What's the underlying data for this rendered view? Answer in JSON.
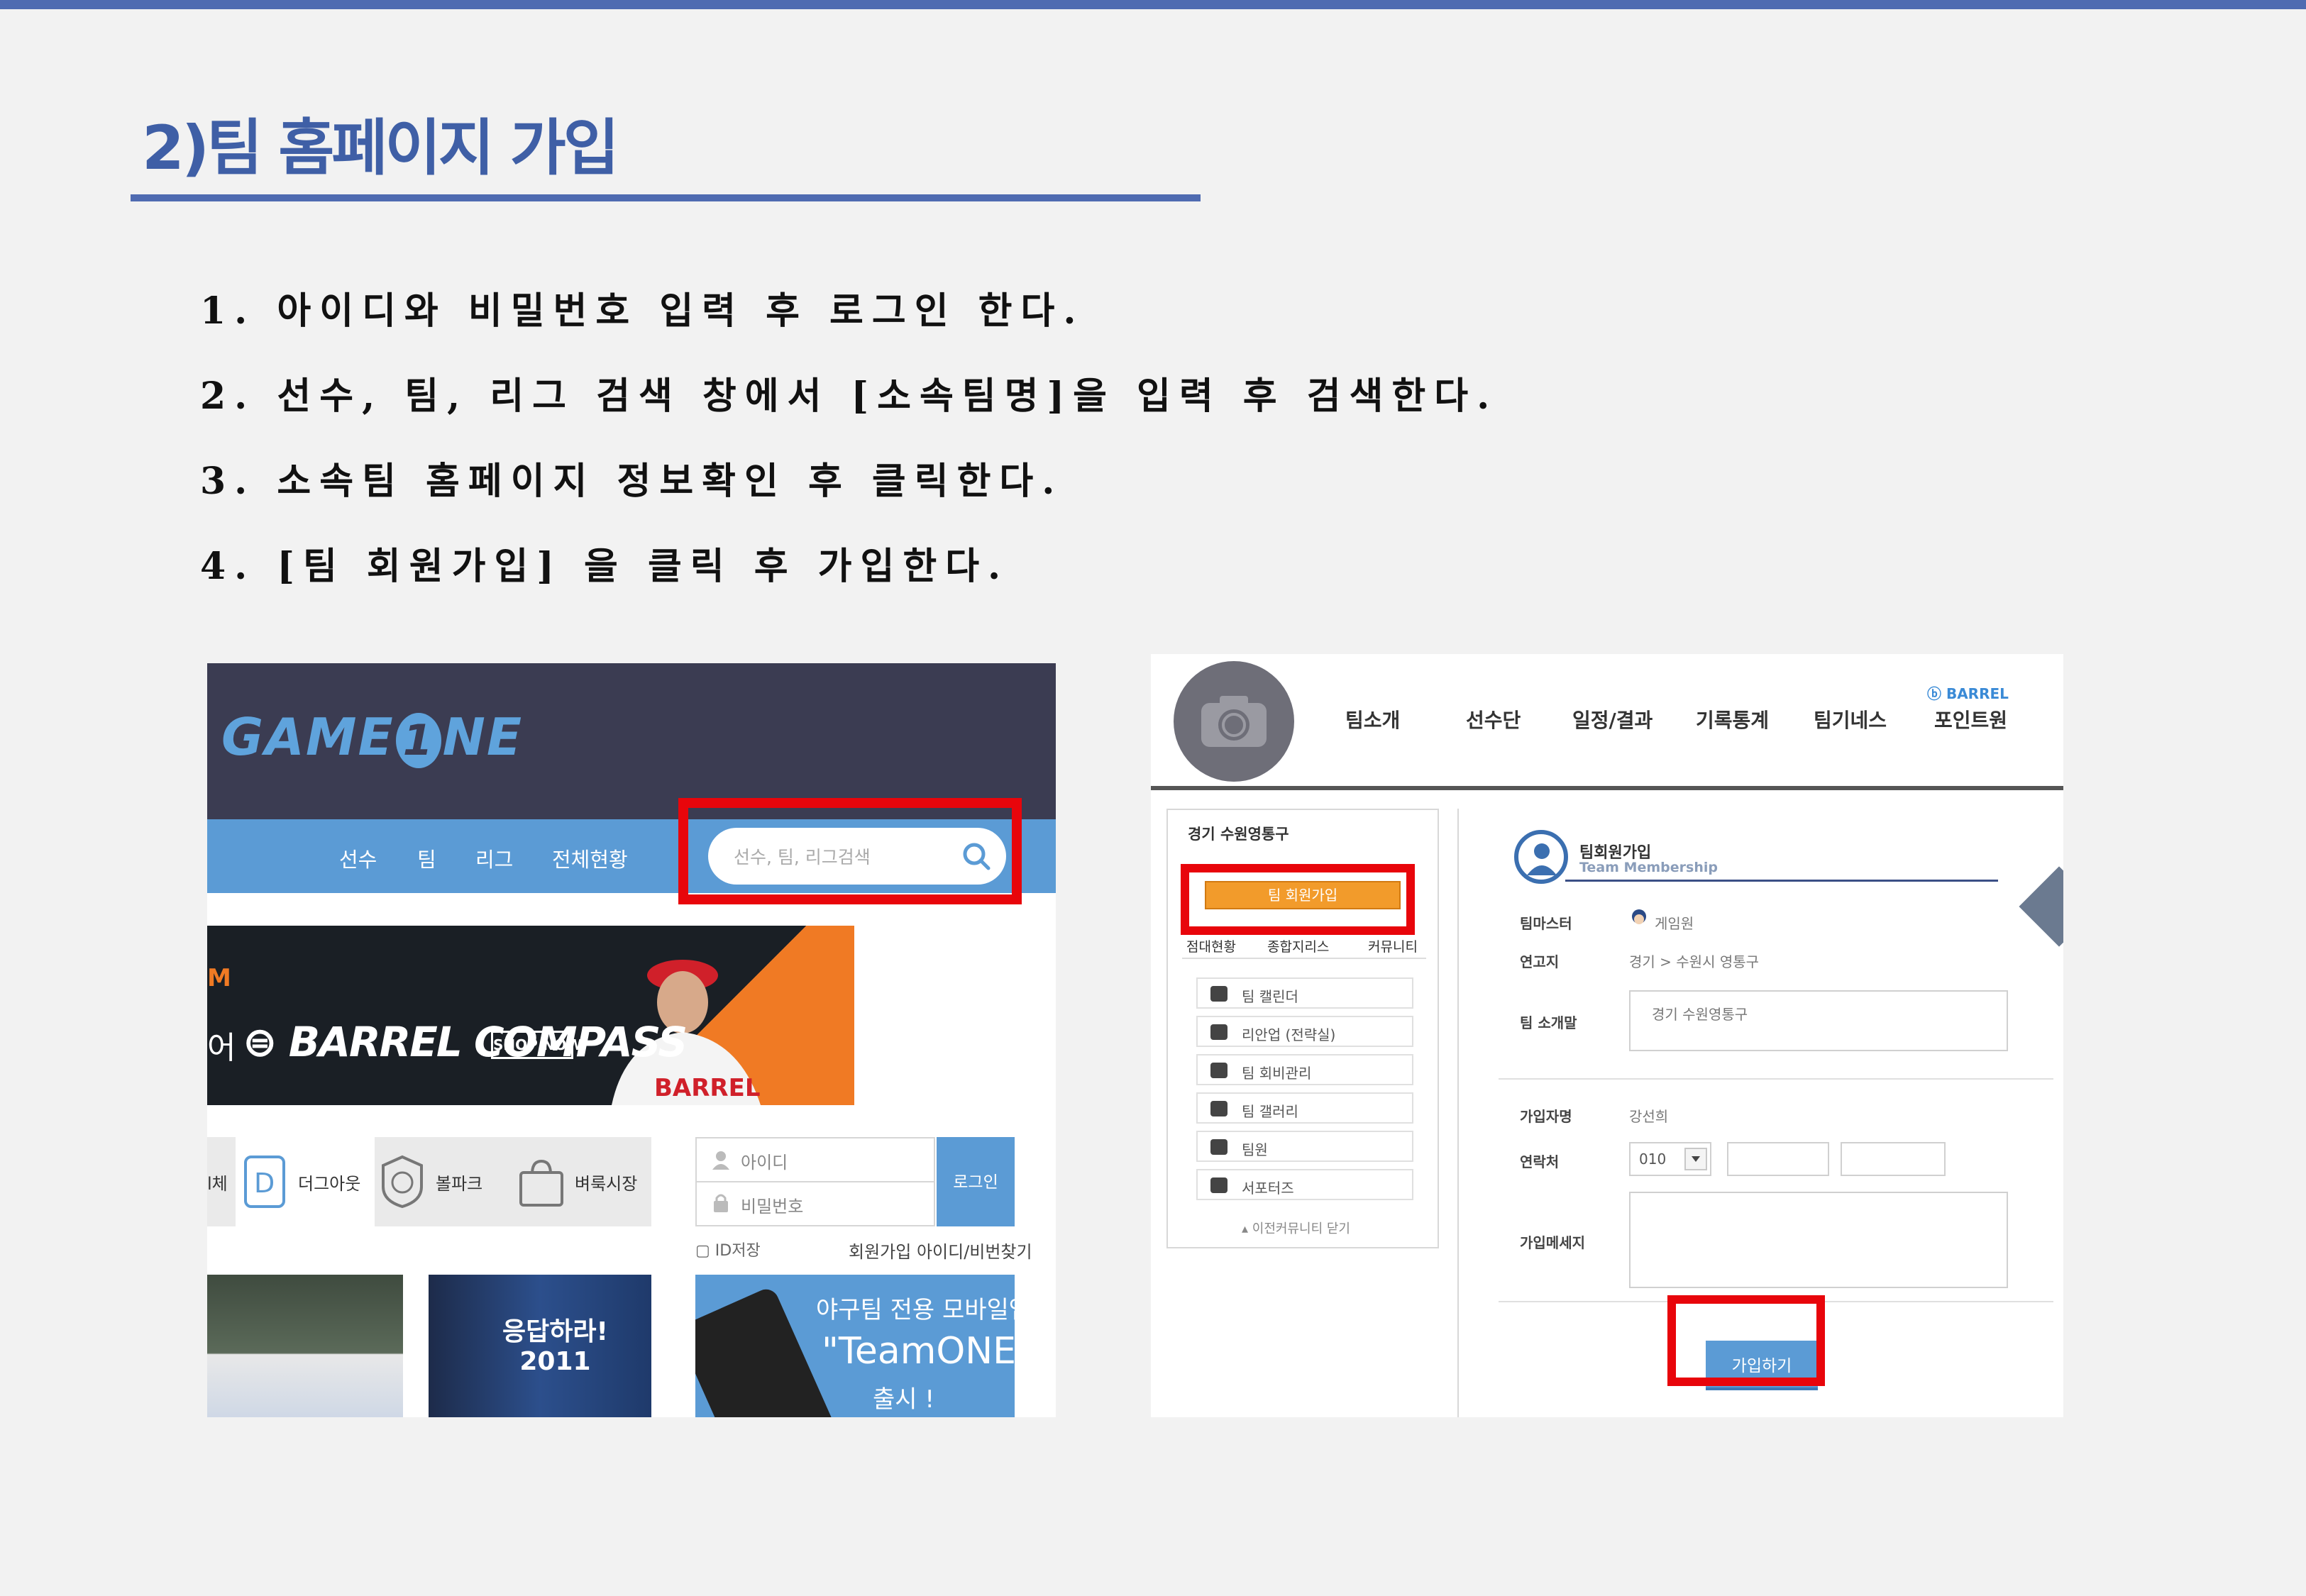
{
  "slide": {
    "title": "2)팀 홈페이지 가입",
    "steps": [
      "1. 아이디와 비밀번호 입력 후 로그인 한다.",
      "2. 선수, 팀, 리그 검색 창에서 [소속팀명]을 입력 후 검색한다.",
      "3. 소속팀 홈페이지 정보확인 후 클릭한다.",
      "4. [팀 회원가입] 을 클릭 후 가입한다."
    ]
  },
  "left": {
    "logo_pre": "GAME",
    "logo_one": "1",
    "logo_post": "NE",
    "nav": [
      "선수",
      "팀",
      "리그",
      "전체현황"
    ],
    "search_placeholder": "선수, 팀, 리그검색",
    "banner_m": "M",
    "banner_eo": "어",
    "banner_compass": "⊜ BARREL COMPASS",
    "banner_shop": "SHOP NOW",
    "icon_items": [
      "l체",
      "더그아웃",
      "볼파크",
      "벼룩시장"
    ],
    "login_id": "아이디",
    "login_pw": "비밀번호",
    "login_button": "로그인",
    "id_save": "ID저장",
    "join_links": "회원가입  아이디/비번찾기",
    "photo2_text": "응답하라!\n2011",
    "app_line1": "야구팀 전용 모바일앱",
    "app_line2": "\"TeamONE\"",
    "app_line3": "출시 !"
  },
  "right": {
    "nav": [
      "팀소개",
      "선수단",
      "일정/결과",
      "기록통계",
      "팀기네스",
      "포인트원"
    ],
    "barrel": "ⓑ BARREL",
    "team_name": "경기 수원영통구",
    "join_button": "팀 회원가입",
    "tabs": [
      "점대현황",
      "종합지리스",
      "커뮤니티"
    ],
    "menu": [
      "팀 캘린더",
      "리안업 (전략실)",
      "팀 회비관리",
      "팀 갤러리",
      "팀원",
      "서포터즈"
    ],
    "collapse": "이전커뮤니티 닫기",
    "form_title": "팀회원가입",
    "form_subtitle": "Team Membership",
    "labels": {
      "master": "팀마스터",
      "region": "연고지",
      "intro": "팀 소개말",
      "name": "가입자명",
      "phone": "연락처",
      "message": "가입메세지"
    },
    "values": {
      "master": "게임원",
      "region": "경기 > 수원시 영통구",
      "intro": "경기 수원영통구",
      "name": "강선희",
      "phone_prefix": "010"
    },
    "submit": "가입하기"
  },
  "colors": {
    "accent": "#4f6bb1",
    "highlight": "#e8050b",
    "site_blue": "#5b9bd5",
    "orange": "#f29b2b"
  }
}
